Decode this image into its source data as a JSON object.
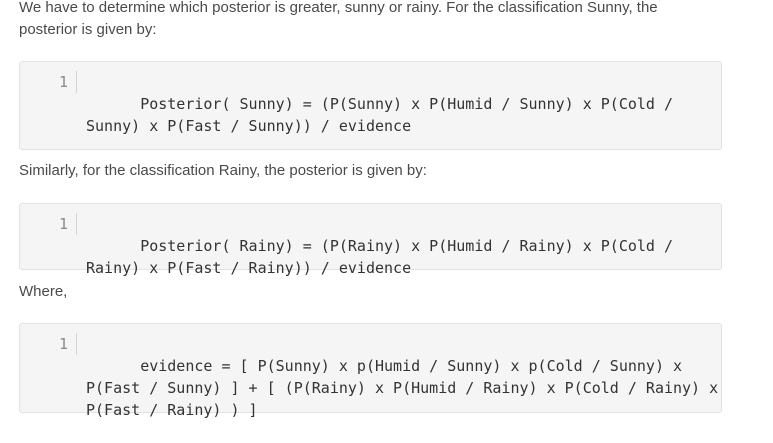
{
  "intro": {
    "text": "We have to determine which posterior is greater, sunny or rainy. For the classification Sunny, the posterior is given by:"
  },
  "code1": {
    "line_number": "1",
    "text": "Posterior( Sunny) = (P(Sunny) x P(Humid / Sunny) x P(Cold / Sunny) x P(Fast / Sunny)) / evidence"
  },
  "rainy_intro": {
    "text": "Similarly, for the classification Rainy, the posterior is given by:"
  },
  "code2": {
    "line_number": "1",
    "text": "Posterior( Rainy) = (P(Rainy) x P(Humid / Rainy) x P(Cold / Rainy) x P(Fast / Rainy)) / evidence"
  },
  "where": {
    "text": "Where,"
  },
  "code3": {
    "line_number": "1",
    "text": "evidence = [ P(Sunny) x p(Humid / Sunny) x p(Cold / Sunny) x P(Fast / Sunny) ] + [ (P(Rainy) x P(Humid / Rainy) x P(Cold / Rainy) x P(Fast / Rainy) ) ]"
  }
}
